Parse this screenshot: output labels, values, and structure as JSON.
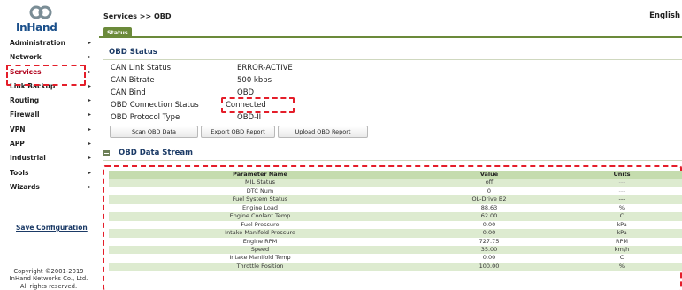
{
  "brand": {
    "logo_text": "InHand"
  },
  "header": {
    "breadcrumb": "Services >> OBD",
    "language": "English"
  },
  "tabs": [
    {
      "label": "Status"
    }
  ],
  "sidebar": {
    "items": [
      {
        "label": "Administration"
      },
      {
        "label": "Network"
      },
      {
        "label": "Services"
      },
      {
        "label": "Link Backup"
      },
      {
        "label": "Routing"
      },
      {
        "label": "Firewall"
      },
      {
        "label": "VPN"
      },
      {
        "label": "APP"
      },
      {
        "label": "Industrial"
      },
      {
        "label": "Tools"
      },
      {
        "label": "Wizards"
      }
    ],
    "save_configuration": "Save Configuration",
    "copyright_line1": "Copyright ©2001-2019",
    "copyright_line2": "InHand Networks Co., Ltd.",
    "copyright_line3": "All rights reserved."
  },
  "obd_status": {
    "title": "OBD Status",
    "fields": [
      {
        "label": "CAN Link Status",
        "value": "ERROR-ACTIVE"
      },
      {
        "label": "CAN Bitrate",
        "value": "500 kbps"
      },
      {
        "label": "CAN Bind",
        "value": "OBD"
      },
      {
        "label": "OBD Connection Status",
        "value": "Connected"
      },
      {
        "label": "OBD Protocol Type",
        "value": "OBD-II"
      }
    ],
    "buttons": {
      "scan": "Scan OBD Data",
      "export": "Export OBD Report",
      "upload": "Upload OBD Report"
    }
  },
  "data_stream": {
    "title": "OBD Data Stream",
    "columns": [
      "Parameter Name",
      "Value",
      "Units"
    ],
    "rows": [
      {
        "name": "MIL Status",
        "value": "off",
        "unit": "---"
      },
      {
        "name": "DTC Num",
        "value": "0",
        "unit": "---"
      },
      {
        "name": "Fuel System Status",
        "value": "OL-Drive B2",
        "unit": "---"
      },
      {
        "name": "Engine Load",
        "value": "88.63",
        "unit": "%"
      },
      {
        "name": "Engine Coolant Temp",
        "value": "62.00",
        "unit": "C"
      },
      {
        "name": "Fuel Pressure",
        "value": "0.00",
        "unit": "kPa"
      },
      {
        "name": "Intake Manifold Pressure",
        "value": "0.00",
        "unit": "kPa"
      },
      {
        "name": "Engine RPM",
        "value": "727.75",
        "unit": "RPM"
      },
      {
        "name": "Speed",
        "value": "35.00",
        "unit": "km/h"
      },
      {
        "name": "Intake Manifold Temp",
        "value": "0.00",
        "unit": "C"
      },
      {
        "name": "Throttle Position",
        "value": "100.00",
        "unit": "%"
      }
    ]
  },
  "colors": {
    "accent_green": "#6b8a3a",
    "row_green": "#ddebd0",
    "header_green": "#c5dcae",
    "highlight_red": "#e41e2a",
    "title_blue": "#1b3a66"
  }
}
